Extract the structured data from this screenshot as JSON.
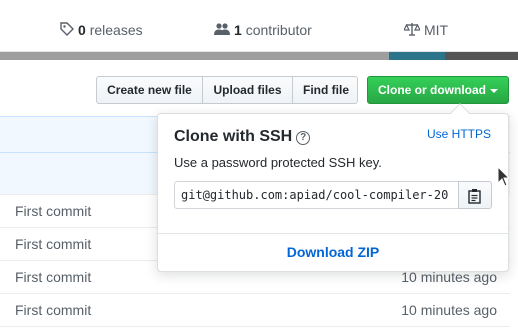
{
  "summary": {
    "releases_count": "0",
    "releases_label": "releases",
    "contributor_count": "1",
    "contributor_label": "contributor",
    "license": "MIT"
  },
  "language_colors": [
    "#9e9e9e",
    "#2b7489",
    "#555555"
  ],
  "toolbar": {
    "create_file": "Create new file",
    "upload_files": "Upload files",
    "find_file": "Find file",
    "clone_download": "Clone or download"
  },
  "files": [
    {
      "message": "First commit",
      "age": ""
    },
    {
      "message": "First commit",
      "age": ""
    },
    {
      "message": "First commit",
      "age": "10 minutes ago"
    },
    {
      "message": "First commit",
      "age": "10 minutes ago"
    }
  ],
  "clone_popover": {
    "title": "Clone with SSH",
    "use_https": "Use HTTPS",
    "description": "Use a password protected SSH key.",
    "url": "git@github.com:apiad/cool-compiler-20",
    "download_zip": "Download ZIP"
  },
  "colors": {
    "accent_green": "#28a745",
    "link_blue": "#0366d6",
    "table_header_bg": "#f1f8ff"
  },
  "icons": [
    "tag-icon",
    "people-icon",
    "law-icon",
    "help-icon",
    "clipboard-icon",
    "caret-down-icon",
    "cursor-icon"
  ]
}
